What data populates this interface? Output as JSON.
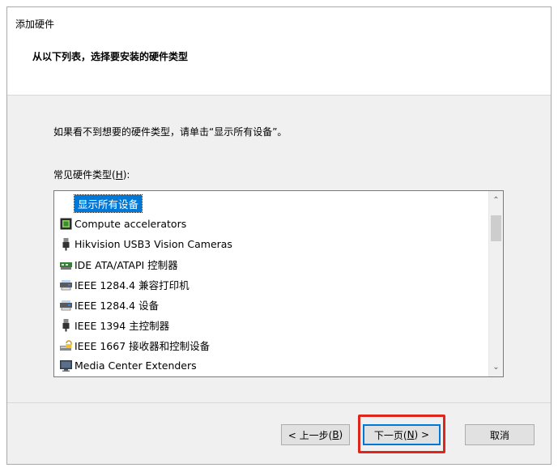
{
  "window": {
    "title": "添加硬件"
  },
  "header": {
    "heading": "从以下列表，选择要安装的硬件类型"
  },
  "instruction": "如果看不到想要的硬件类型，请单击“显示所有设备”。",
  "list": {
    "label_prefix": "常见硬件类型(",
    "label_key": "H",
    "label_suffix": "):",
    "items": [
      {
        "label": "显示所有设备",
        "icon": "none",
        "selected": true
      },
      {
        "label": "Compute accelerators",
        "icon": "chip-icon",
        "selected": false
      },
      {
        "label": "Hikvision USB3 Vision Cameras",
        "icon": "usb-plug-icon",
        "selected": false
      },
      {
        "label": "IDE ATA/ATAPI 控制器",
        "icon": "ide-controller-icon",
        "selected": false
      },
      {
        "label": "IEEE 1284.4 兼容打印机",
        "icon": "printer-icon",
        "selected": false
      },
      {
        "label": "IEEE 1284.4 设备",
        "icon": "printer-icon",
        "selected": false
      },
      {
        "label": "IEEE 1394 主控制器",
        "icon": "usb-plug-icon",
        "selected": false
      },
      {
        "label": "IEEE 1667 接收器和控制设备",
        "icon": "drive-lock-icon",
        "selected": false
      },
      {
        "label": "Media Center Extenders",
        "icon": "monitor-icon",
        "selected": false
      }
    ]
  },
  "buttons": {
    "back_prefix": "< 上一步(",
    "back_key": "B",
    "back_suffix": ")",
    "next_prefix": "下一页(",
    "next_key": "N",
    "next_suffix": ") >",
    "cancel": "取消"
  },
  "colors": {
    "selection": "#0078d7",
    "highlight": "#e0251b"
  }
}
